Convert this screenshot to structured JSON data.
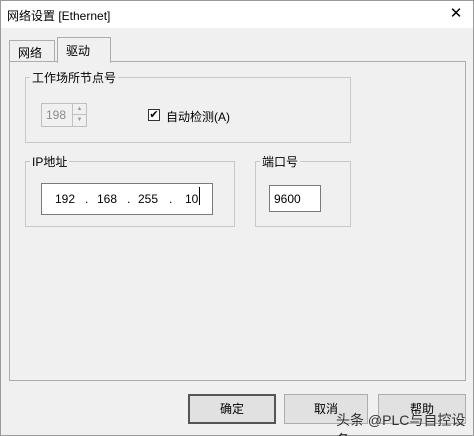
{
  "window": {
    "title": "网络设置 [Ethernet]",
    "close_glyph": "✕"
  },
  "tabs": [
    {
      "label": "网络",
      "active": false
    },
    {
      "label": "驱动",
      "active": true
    }
  ],
  "station_group": {
    "legend": "工作场所节点号",
    "spin_value": "198",
    "auto_detect_label": "自动检测(A)",
    "auto_detect_checked": true,
    "check_glyph": "✔"
  },
  "ip_group": {
    "legend": "IP地址",
    "octets": [
      "192",
      "168",
      "255",
      "10"
    ],
    "separator": "."
  },
  "port_group": {
    "legend": "端口号",
    "value": "9600"
  },
  "buttons": {
    "ok": "确定",
    "cancel": "取消",
    "help": "帮助"
  },
  "watermark": "头条 @PLC与自控设备"
}
